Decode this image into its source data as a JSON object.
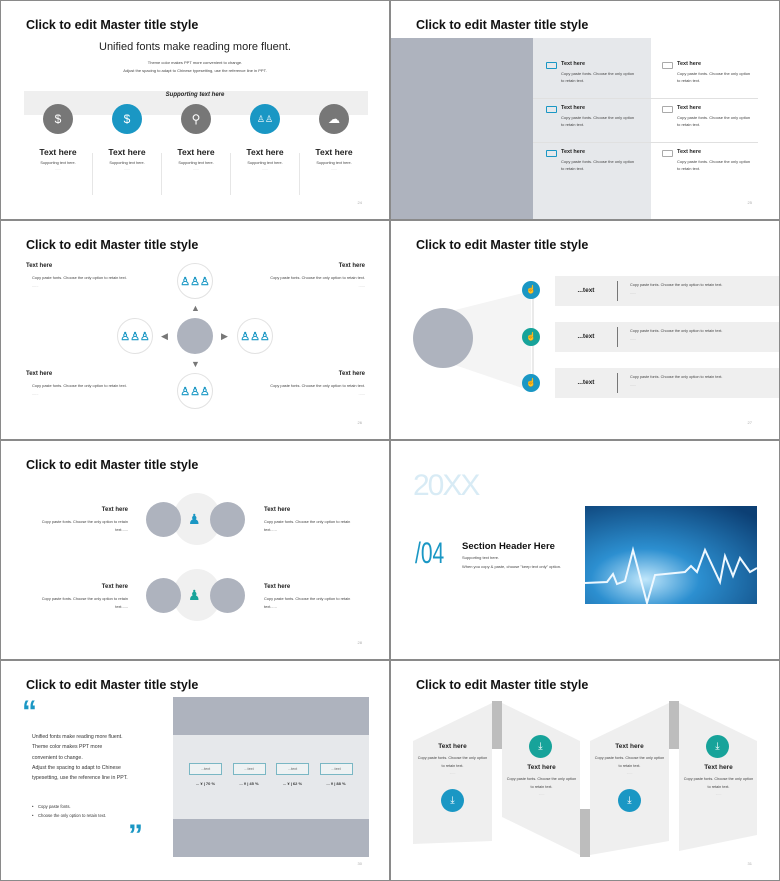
{
  "master_title": "Click to edit Master title style",
  "colors": {
    "accent_blue": "#1a97c4",
    "accent_teal": "#17a39a",
    "neutral_gray": "#777777",
    "placeholder_gray": "#aeb3be",
    "panel_gray": "#e6e8eb"
  },
  "slide1": {
    "headline": "Unified fonts make reading more fluent.",
    "sub1": "Theme color makes PPT more convenient to change.",
    "sub2": "Adjust the spacing to adapt to Chinese typesetting, use the reference line in PPT.",
    "band_label": "Supporting text here",
    "items": [
      {
        "icon": "money-hand-icon",
        "title": "Text here",
        "text": "Supporting text here.",
        "dash": "......"
      },
      {
        "icon": "dollar-globe-icon",
        "title": "Text here",
        "text": "Supporting text here.",
        "dash": "......"
      },
      {
        "icon": "location-pin-icon",
        "title": "Text here",
        "text": "Supporting text here.",
        "dash": "......"
      },
      {
        "icon": "team-icon",
        "title": "Text here",
        "text": "Supporting text here.",
        "dash": "......"
      },
      {
        "icon": "cloud-network-icon",
        "title": "Text here",
        "text": "Supporting text here.",
        "dash": "......"
      }
    ],
    "page": "24"
  },
  "slide2": {
    "items": [
      {
        "title": "Text here",
        "text": "Copy paste fonts. Choose the only option to retain text."
      },
      {
        "title": "Text here",
        "text": "Copy paste fonts. Choose the only option to retain text."
      },
      {
        "title": "Text here",
        "text": "Copy paste fonts. Choose the only option to retain text."
      },
      {
        "title": "Text here",
        "text": "Copy paste fonts. Choose the only option to retain text."
      },
      {
        "title": "Text here",
        "text": "Copy paste fonts. Choose the only option to retain text."
      },
      {
        "title": "Text here",
        "text": "Copy paste fonts. Choose the only option to retain text."
      }
    ],
    "page": "25"
  },
  "slide3": {
    "blocks": [
      {
        "title": "Text here",
        "bullet1": "Copy paste fonts. Choose the only option to retain text.",
        "bullet2": "......"
      },
      {
        "title": "Text here",
        "bullet1": "Copy paste fonts. Choose the only option to retain text.",
        "bullet2": "......"
      },
      {
        "title": "Text here",
        "bullet1": "Copy paste fonts. Choose the only option to retain text.",
        "bullet2": "......"
      },
      {
        "title": "Text here",
        "bullet1": "Copy paste fonts. Choose the only option to retain text.",
        "bullet2": "......"
      }
    ],
    "page": "26"
  },
  "slide4": {
    "rows": [
      {
        "label": "...text",
        "bullet1": "Copy paste fonts. Choose the only option to retain text.",
        "bullet2": "......"
      },
      {
        "label": "...text",
        "bullet1": "Copy paste fonts. Choose the only option to retain text.",
        "bullet2": "......"
      },
      {
        "label": "...text",
        "bullet1": "Copy paste fonts. Choose the only option to retain text.",
        "bullet2": "......"
      }
    ],
    "page": "27"
  },
  "slide5": {
    "blocks": [
      {
        "title": "Text here",
        "text": "Copy paste fonts. Choose the only option to retain text......"
      },
      {
        "title": "Text here",
        "text": "Copy paste fonts. Choose the only option to retain text......"
      },
      {
        "title": "Text here",
        "text": "Copy paste fonts. Choose the only option to retain text......"
      },
      {
        "title": "Text here",
        "text": "Copy paste fonts. Choose the only option to retain text......"
      }
    ],
    "page": "28"
  },
  "slide6": {
    "year": "20XX",
    "number": "/04",
    "header": "Section Header Here",
    "sub1": "Supporting text here.",
    "sub2": "When you copy & paste, choose \"keep text only\" option."
  },
  "slide7": {
    "open_quote": "“",
    "close_quote": "”",
    "paragraph": [
      "Unified fonts make reading more fluent.",
      "Theme color makes PPT more",
      "convenient to change.",
      "Adjust the spacing to adapt to Chinese",
      "typesetting, use the reference line in PPT."
    ],
    "bullets": [
      "Copy paste fonts.",
      "Choose the only option to retain text."
    ],
    "stats": [
      {
        "label": "...text",
        "value": "... ¥ | 70 %"
      },
      {
        "label": "...text",
        "value": "... ¥ | 45 %"
      },
      {
        "label": "...text",
        "value": "... ¥ | 62 %"
      },
      {
        "label": "...text",
        "value": "... ¥ | 88 %"
      }
    ],
    "page": "30"
  },
  "slide8": {
    "items": [
      {
        "title": "Text here",
        "text": "Copy paste fonts. Choose the only option to retain text.",
        "dash": "......"
      },
      {
        "title": "Text here",
        "text": "Copy paste fonts. Choose the only option to retain text.",
        "dash": "......"
      },
      {
        "title": "Text here",
        "text": "Copy paste fonts. Choose the only option to retain text.",
        "dash": "......"
      },
      {
        "title": "Text here",
        "text": "Copy paste fonts. Choose the only option to retain text.",
        "dash": "......"
      }
    ],
    "page": "31"
  }
}
